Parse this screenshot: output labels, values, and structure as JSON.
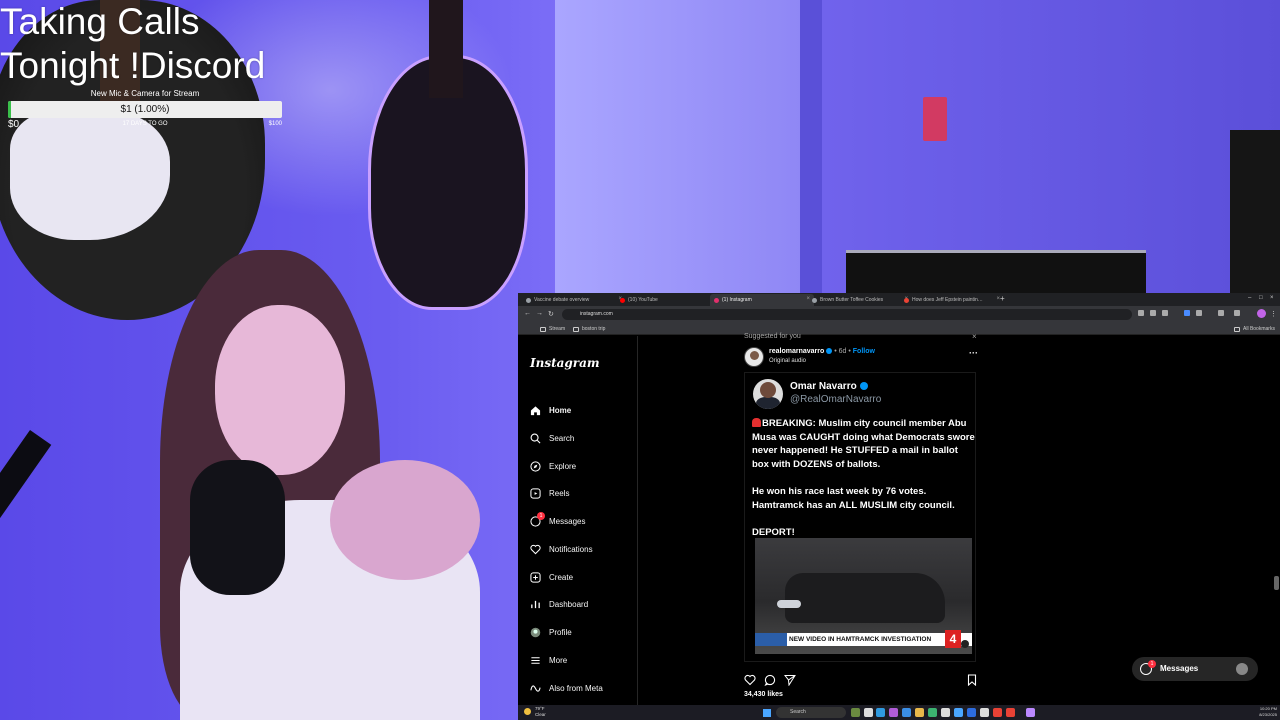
{
  "overlay": {
    "title_line1": "Taking Calls",
    "title_line2": "Tonight !Discord",
    "goal": {
      "label": "New Mic & Camera for Stream",
      "value_text": "$1 (1.00%)",
      "progress_fraction": 0.01,
      "start": "$0",
      "days_left": "17 DAYS TO GO",
      "target": "$100",
      "fill_color": "#39c04a"
    }
  },
  "browser": {
    "tabs": [
      {
        "label": "Vaccine debate overview",
        "icon_color": "#9aa0a6",
        "active": false
      },
      {
        "label": "(10) YouTube",
        "icon_color": "#ff0000",
        "active": false
      },
      {
        "label": "(1) Instagram",
        "icon_color": "#e1306c",
        "active": true
      },
      {
        "label": "Brown Butter Toffee Cookies",
        "icon_color": "#9aa0a6",
        "active": false
      },
      {
        "label": "How does Jeff Epstein paintin…",
        "icon_color": "#ea4335",
        "active": false
      }
    ],
    "url": "instagram.com",
    "bookmarks": [
      "Stream",
      "boston trip"
    ],
    "all_bookmarks": "All Bookmarks"
  },
  "instagram": {
    "logo": "Instagram",
    "nav": [
      {
        "label": "Home",
        "icon": "home-icon",
        "active": true
      },
      {
        "label": "Search",
        "icon": "search-icon"
      },
      {
        "label": "Explore",
        "icon": "compass-icon"
      },
      {
        "label": "Reels",
        "icon": "reels-icon"
      },
      {
        "label": "Messages",
        "icon": "messenger-icon",
        "badge": "1"
      },
      {
        "label": "Notifications",
        "icon": "heart-icon"
      },
      {
        "label": "Create",
        "icon": "plus-square-icon"
      },
      {
        "label": "Dashboard",
        "icon": "dashboard-icon"
      },
      {
        "label": "Profile",
        "icon": "profile-avatar-icon"
      },
      {
        "label": "More",
        "icon": "hamburger-icon"
      },
      {
        "label": "Also from Meta",
        "icon": "meta-icon"
      }
    ],
    "post": {
      "suggested": "Suggested for you",
      "username": "realomarnavarro",
      "time": "6d",
      "follow": "Follow",
      "audio": "Original audio",
      "tweet": {
        "name": "Omar Navarro",
        "handle": "@RealOmarNavarro",
        "text": "BREAKING: Muslim city council member Abu Musa was CAUGHT doing what Democrats swore never happened! He STUFFED a mail in ballot box with DOZENS of ballots.\n\nHe won his race last week by 76 votes. Hamtramck has an ALL MUSLIM city council.\n\nDEPORT!",
        "video_banner": "NEW VIDEO IN HAMTRAMCK INVESTIGATION",
        "station_logo": "4"
      },
      "likes": "34,430 likes"
    },
    "messages_button": {
      "label": "Messages",
      "badge": "1"
    }
  },
  "taskbar": {
    "weather_temp": "79°F",
    "weather_cond": "Clear",
    "search_placeholder": "Search",
    "time": "10:20 PM",
    "date": "8/23/2025"
  }
}
